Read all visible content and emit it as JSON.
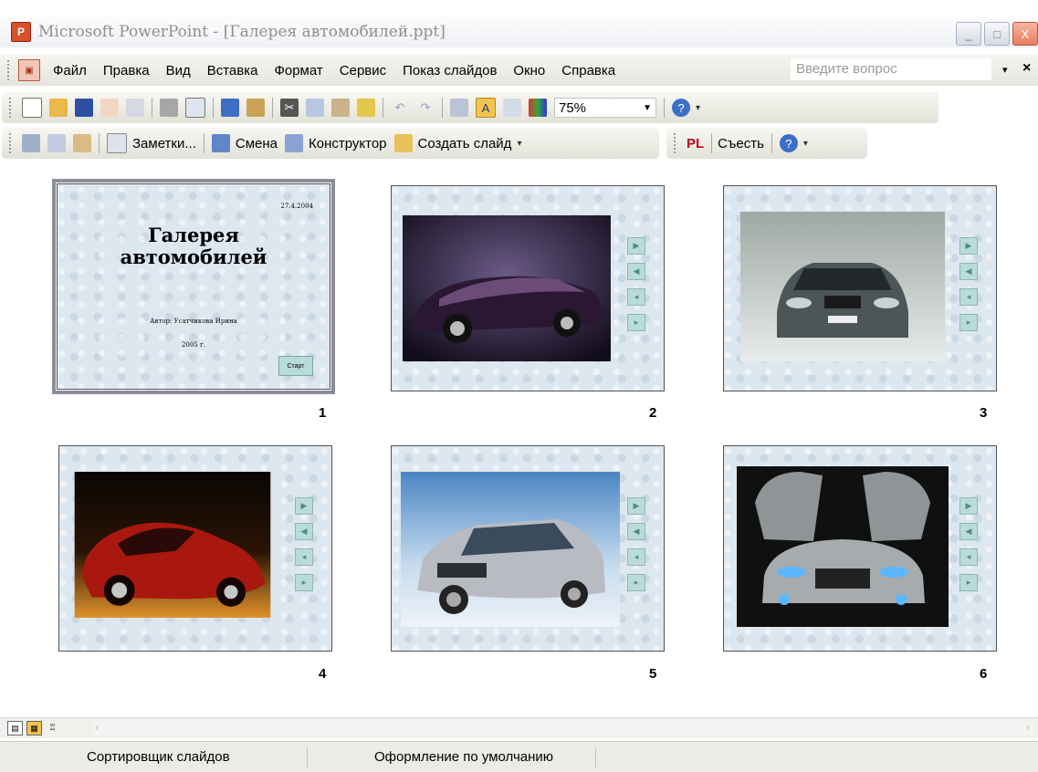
{
  "window": {
    "title": "Microsoft PowerPoint - [Галерея автомобилей.ppt]",
    "buttons": [
      "_",
      "□",
      "X"
    ]
  },
  "menu": {
    "items": [
      "Файл",
      "Правка",
      "Вид",
      "Вставка",
      "Формат",
      "Сервис",
      "Показ слайдов",
      "Окно",
      "Справка"
    ],
    "ask_placeholder": "Введите вопрос",
    "dropdown": "▾",
    "close": "×"
  },
  "toolbar_standard": {
    "zoom": "75%",
    "icons": [
      "new-icon",
      "open-icon",
      "save-icon",
      "permission-icon",
      "email-icon",
      "print-icon",
      "print-preview-icon",
      "spelling-icon",
      "research-icon",
      "cut-icon",
      "copy-icon",
      "paste-icon",
      "format-painter-icon",
      "undo-icon",
      "redo-icon",
      "expand-icon",
      "show-formatting-icon",
      "grid-icon",
      "color-icon",
      "help-icon"
    ]
  },
  "toolbar_sorter": {
    "notes": "Заметки...",
    "transition": "Смена",
    "design": "Конструктор",
    "new_slide": "Создать слайд"
  },
  "toolbar_extra": {
    "pl": "PL",
    "label": "Съесть"
  },
  "slides": [
    {
      "number": "1",
      "date": "27.4.2004",
      "title_line1": "Галерея",
      "title_line2": "автомобилей",
      "author": "Автор: Усатчикова Ирина",
      "year": "2005 г.",
      "start": "Старт"
    },
    {
      "number": "2",
      "photo": "dark purple roadster"
    },
    {
      "number": "3",
      "photo": "grey BMW front view"
    },
    {
      "number": "4",
      "photo": "red sports car"
    },
    {
      "number": "5",
      "photo": "silver BMW X5"
    },
    {
      "number": "6",
      "photo": "concept car gull-wing doors"
    }
  ],
  "status": {
    "view": "Сортировщик слайдов",
    "design": "Оформление по умолчанию"
  }
}
